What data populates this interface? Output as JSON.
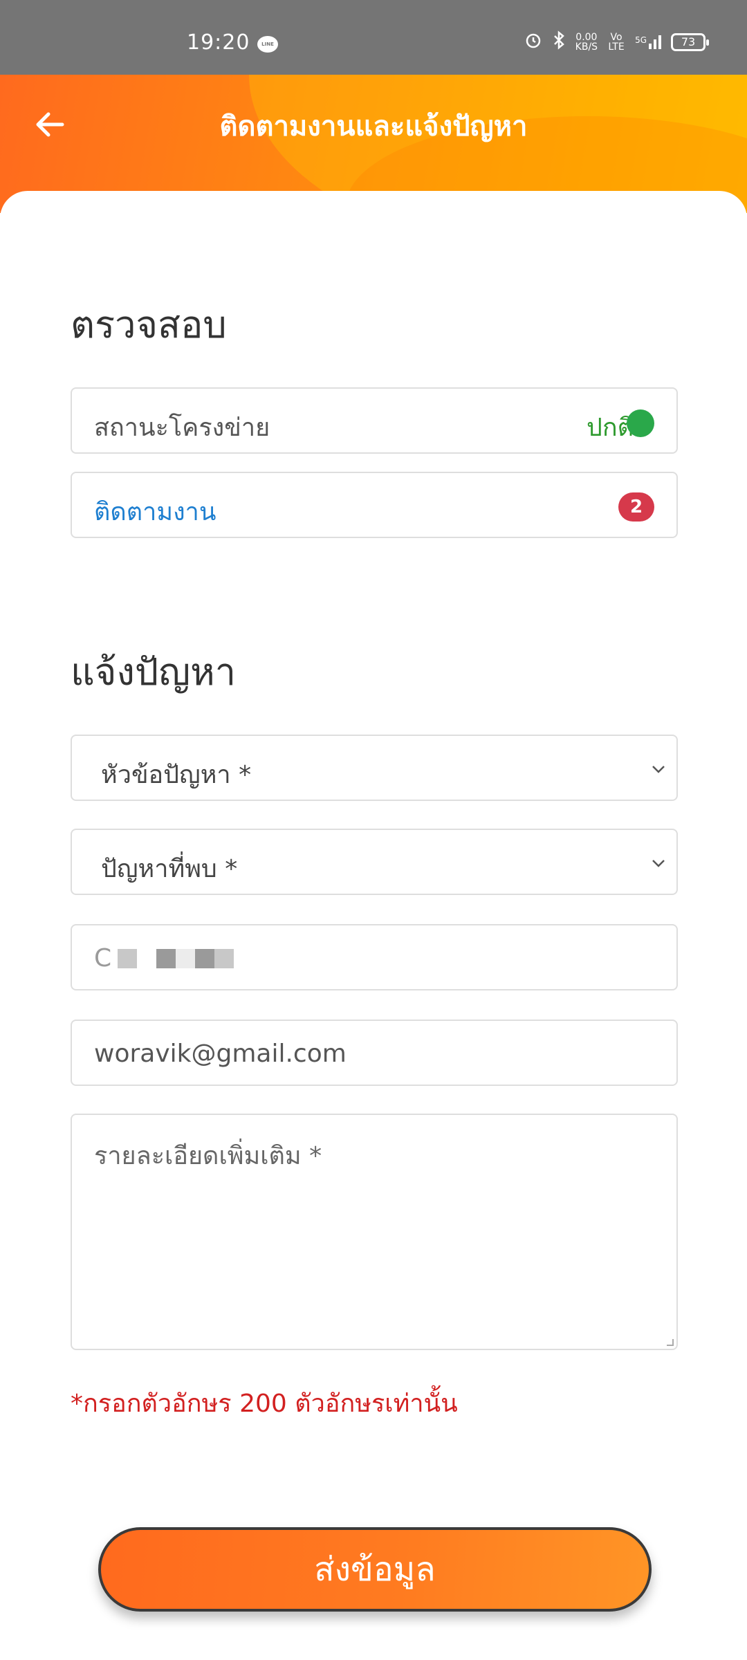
{
  "status_bar": {
    "time": "19:20",
    "line_icon": "LINE",
    "net_speed_value": "0.00",
    "net_speed_unit": "KB/S",
    "volte": "Vo LTE",
    "network": "5G",
    "battery": "73"
  },
  "header": {
    "title": "ติดตามงานและแจ้งปัญหา",
    "back_icon": "arrow-left-icon"
  },
  "check_section": {
    "title": "ตรวจสอบ",
    "network_status_label": "สถานะโครงข่าย",
    "network_status_value": "ปกติ",
    "track_jobs_label": "ติดตามงาน",
    "track_jobs_count": "2"
  },
  "report_section": {
    "title": "แจ้งปัญหา",
    "topic_select": "หัวข้อปัญหา *",
    "problem_select": "ปัญหาที่พบ *",
    "phone_value": "C",
    "email_value": "woravik@gmail.com",
    "details_placeholder": "รายละเอียดเพิ่มเติม *",
    "note": "*กรอกตัวอักษร 200 ตัวอักษรเท่านั้น",
    "submit_label": "ส่งข้อมูล"
  },
  "colors": {
    "accent": "#ff7a1e",
    "status_ok": "#2aa84a",
    "badge": "#d6394b",
    "link": "#1e7fd0",
    "warning": "#d22020"
  }
}
